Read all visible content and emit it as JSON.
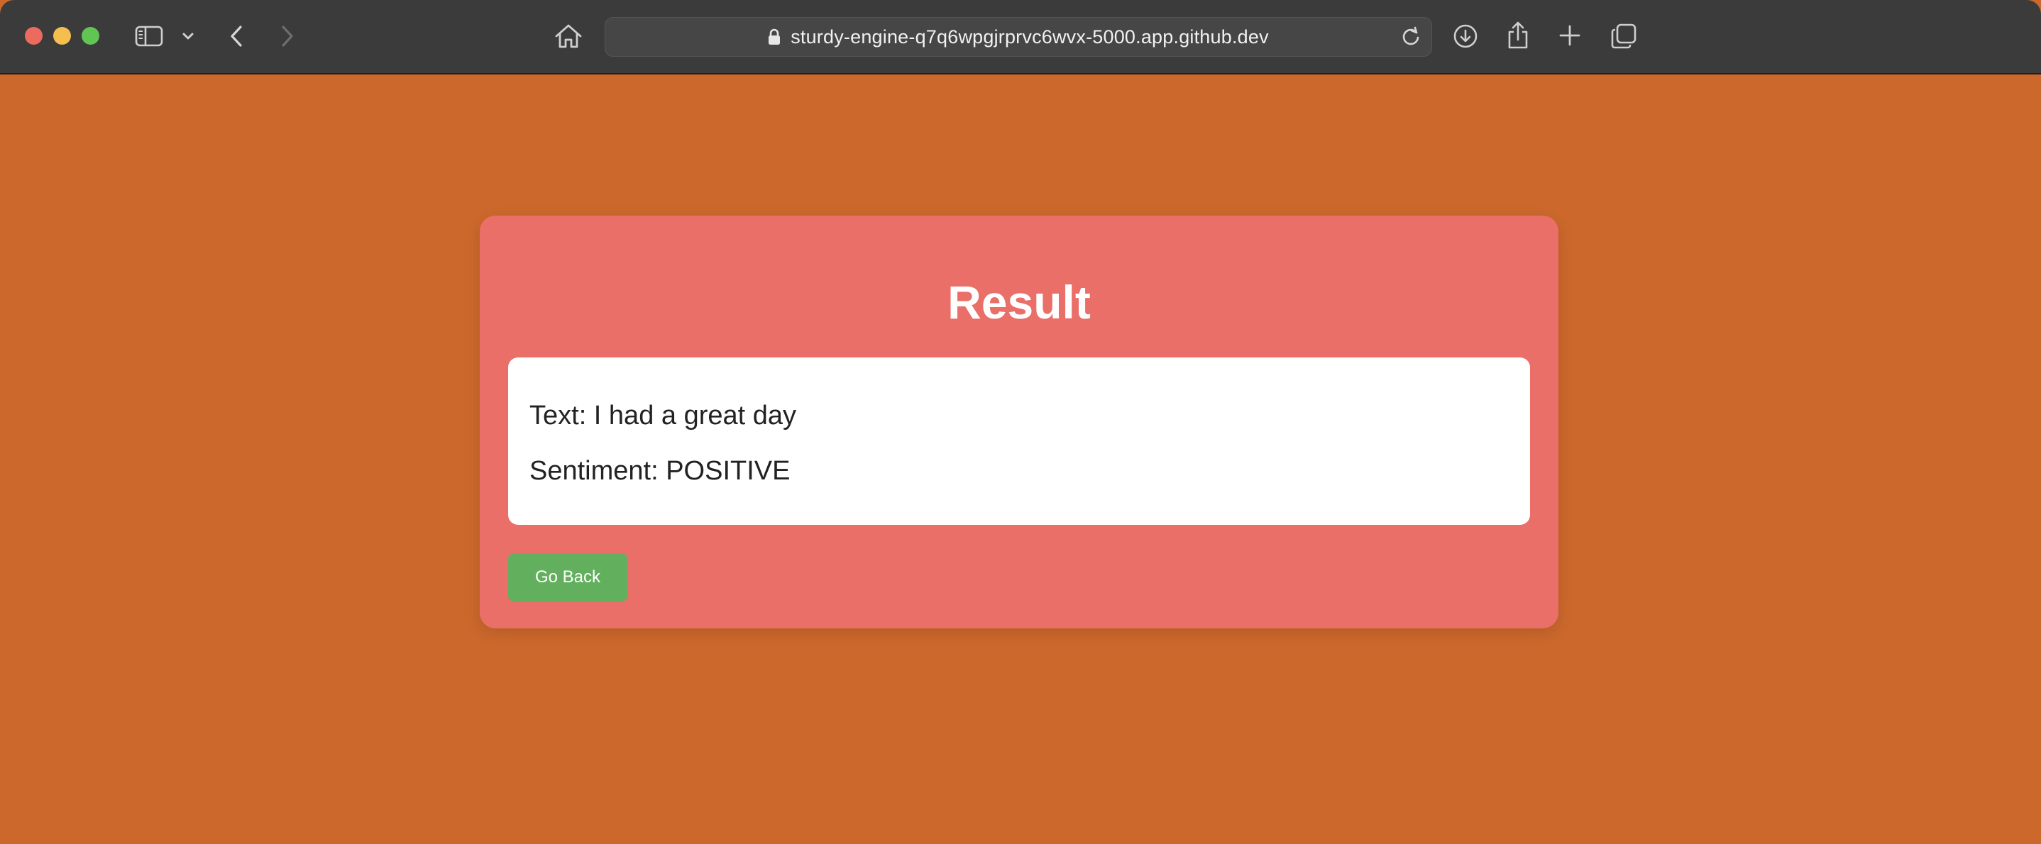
{
  "browser": {
    "url": "sturdy-engine-q7q6wpgjrprvc6wvx-5000.app.github.dev",
    "icons": [
      "sidebar-icon",
      "chevron-down-icon",
      "back-arrow-icon",
      "forward-arrow-icon",
      "home-icon",
      "lock-icon",
      "reload-icon",
      "download-icon",
      "share-icon",
      "new-tab-icon",
      "tab-overview-icon"
    ]
  },
  "page": {
    "title": "Result",
    "text_line": "Text: I had a great day",
    "sentiment_line": "Sentiment: POSITIVE",
    "back_button_label": "Go Back"
  },
  "colors": {
    "background": "#cc682c",
    "card": "#e96f68",
    "button": "#62b05e"
  }
}
